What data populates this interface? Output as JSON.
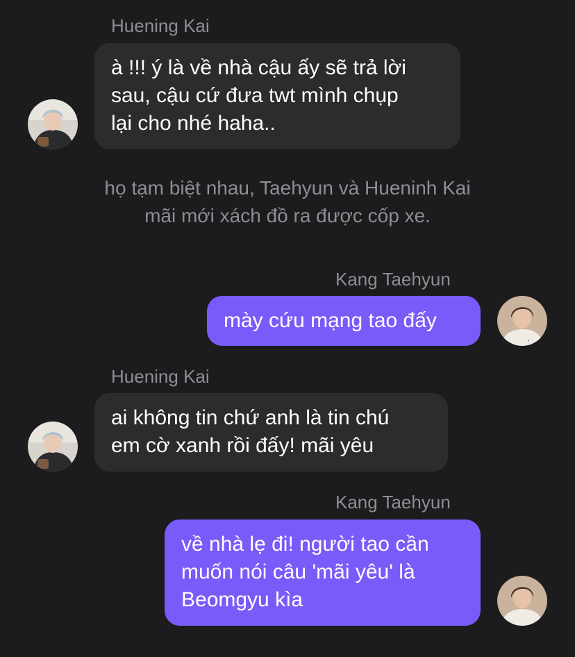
{
  "messages": [
    {
      "sender": "Huening Kai",
      "direction": "incoming",
      "lines": [
        "à !!! ý là về nhà cậu ấy sẽ trả lời",
        "sau, cậu cứ đưa twt mình chụp",
        "lại cho nhé haha.."
      ]
    },
    {
      "sender": "Kang Taehyun",
      "direction": "outgoing",
      "lines": [
        "mày cứu mạng tao đấy"
      ]
    },
    {
      "sender": "Huening Kai",
      "direction": "incoming",
      "lines": [
        "ai không tin chứ anh là tin chú",
        "em cờ xanh rồi đấy! mãi yêu"
      ]
    },
    {
      "sender": "Kang Taehyun",
      "direction": "outgoing",
      "lines": [
        "về nhà lẹ đi! người tao cần",
        "muốn nói câu 'mãi yêu' là",
        "Beomgyu kìa"
      ]
    }
  ],
  "narration": {
    "lines": [
      "họ tạm biệt nhau, Taehyun và Hueninh Kai",
      "mãi mới xách đồ ra được cốp xe."
    ]
  },
  "colors": {
    "background": "#1c1c1e",
    "incoming_bubble": "#2c2c2e",
    "outgoing_bubble": "#7a5af8",
    "secondary_text": "#8e8e93"
  },
  "icons": {
    "huening_kai_avatar": "profile-photo",
    "kang_taehyun_avatar": "profile-photo"
  }
}
